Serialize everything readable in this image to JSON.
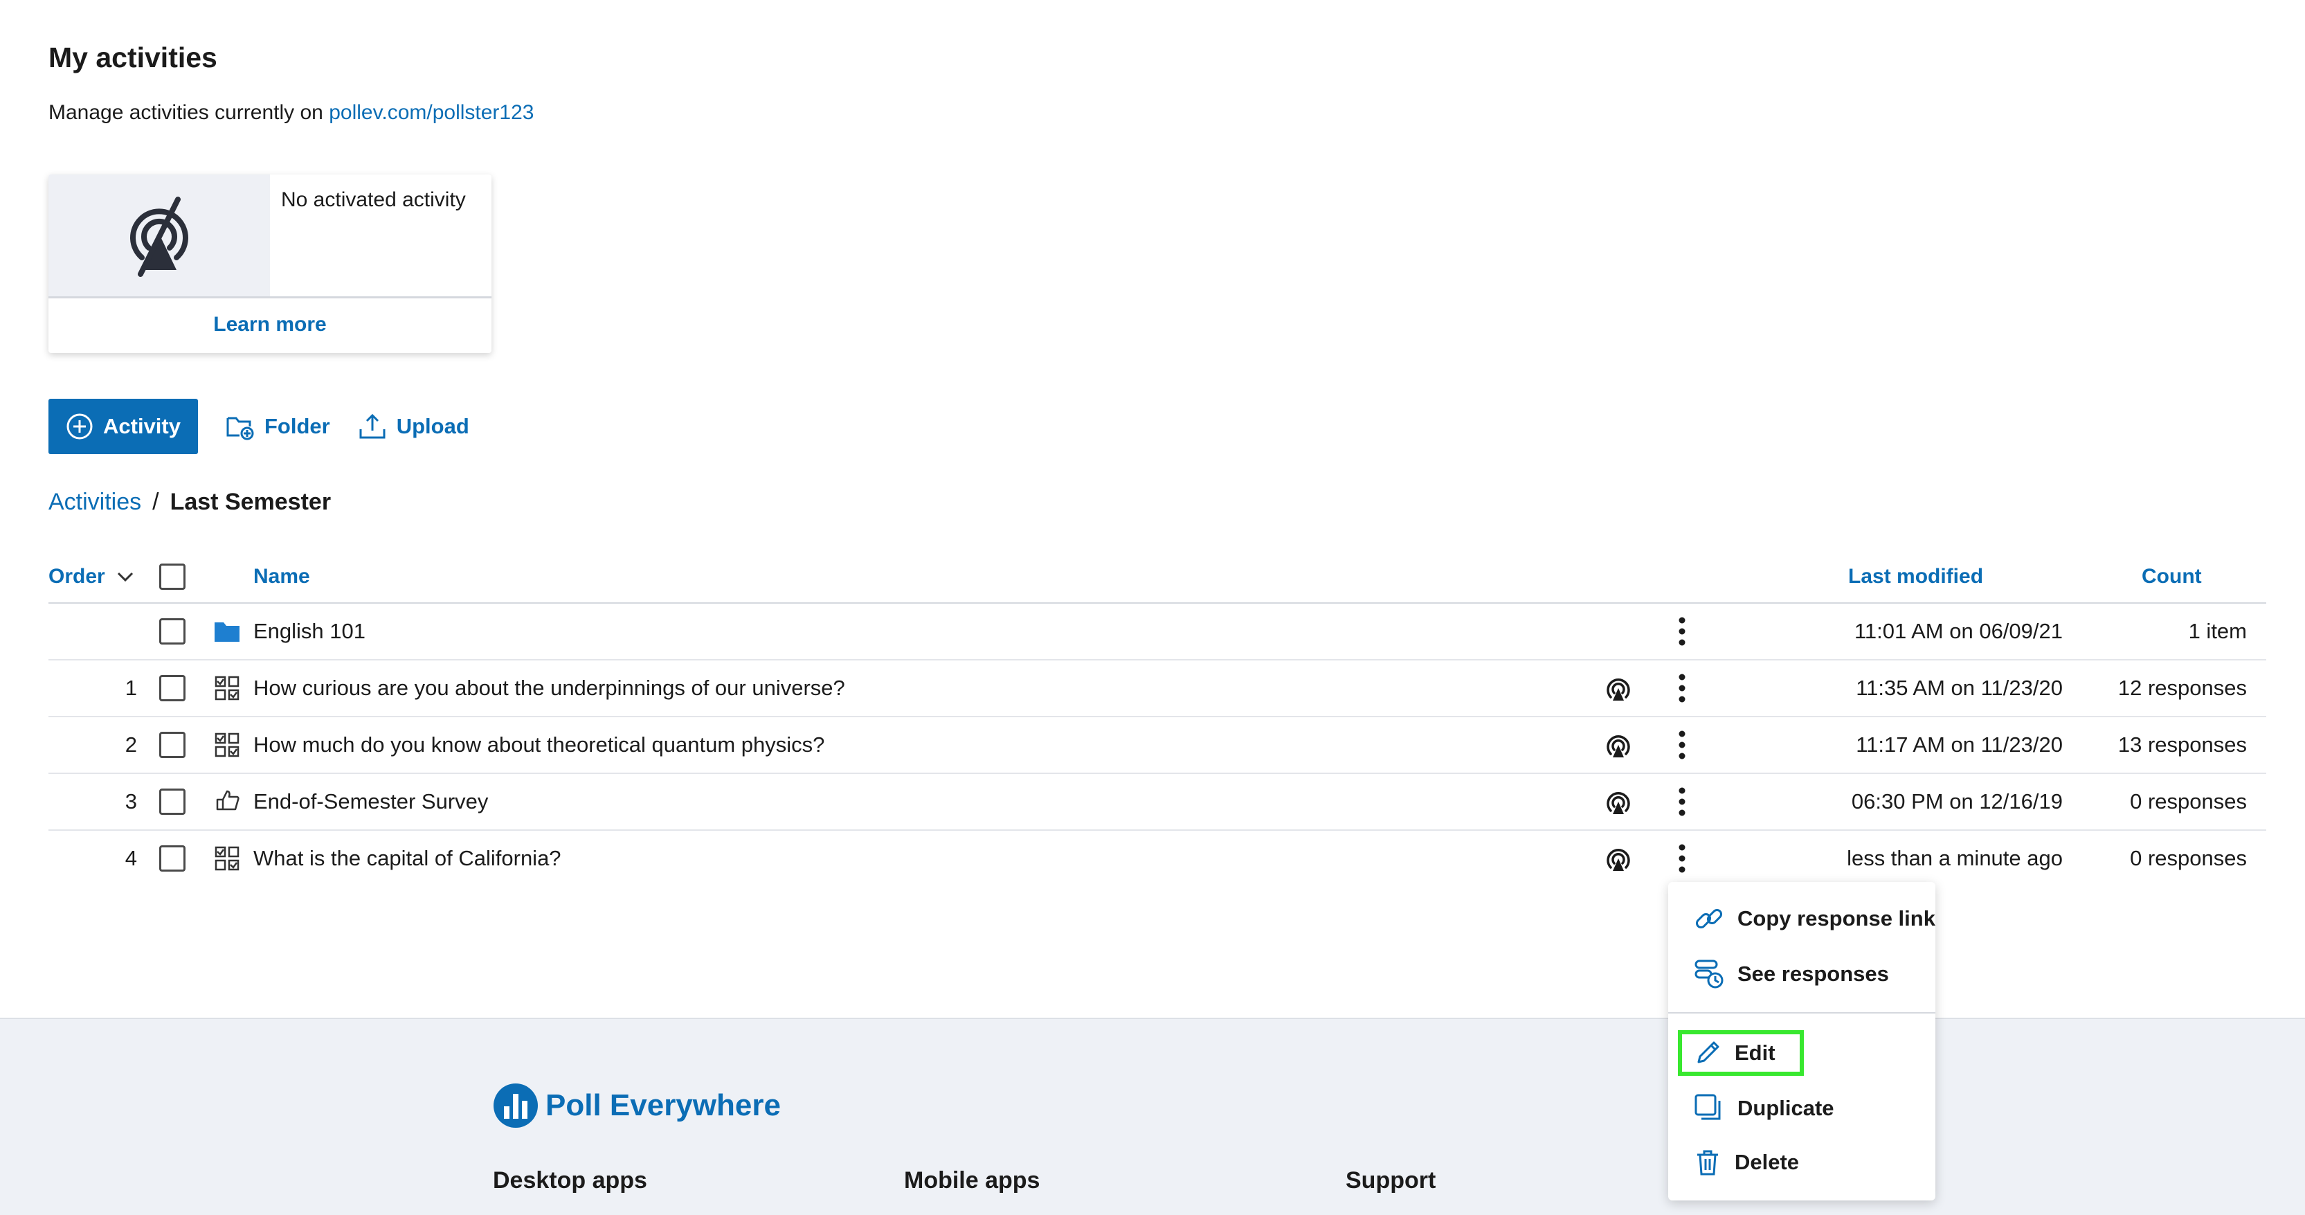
{
  "header": {
    "title": "My activities",
    "subtitle_prefix": "Manage activities currently on",
    "subtitle_link": "pollev.com/pollster123"
  },
  "activation_card": {
    "status": "No activated activity",
    "learn_more": "Learn more",
    "icon": "broadcast-off-icon"
  },
  "toolbar": {
    "activity": "Activity",
    "folder": "Folder",
    "upload": "Upload"
  },
  "breadcrumb": {
    "root": "Activities",
    "separator": "/",
    "current": "Last Semester"
  },
  "table": {
    "headers": {
      "order": "Order",
      "name": "Name",
      "last_modified": "Last modified",
      "count": "Count"
    },
    "rows": [
      {
        "order": "",
        "type": "folder",
        "name": "English 101",
        "broadcast": false,
        "modified": "11:01 AM on 06/09/21",
        "count": "1 item"
      },
      {
        "order": "1",
        "type": "multiple-choice",
        "name": "How curious are you about the underpinnings of our universe?",
        "broadcast": true,
        "modified": "11:35 AM on 11/23/20",
        "count": "12 responses"
      },
      {
        "order": "2",
        "type": "multiple-choice",
        "name": "How much do you know about theoretical quantum physics?",
        "broadcast": true,
        "modified": "11:17 AM on 11/23/20",
        "count": "13 responses"
      },
      {
        "order": "3",
        "type": "survey",
        "name": "End-of-Semester Survey",
        "broadcast": true,
        "modified": "06:30 PM on 12/16/19",
        "count": "0 responses"
      },
      {
        "order": "4",
        "type": "multiple-choice",
        "name": "What is the capital of California?",
        "broadcast": true,
        "modified": "less than a minute ago",
        "count": "0 responses"
      }
    ]
  },
  "context_menu": {
    "items": [
      {
        "label": "Copy response link",
        "icon": "link-icon"
      },
      {
        "label": "See responses",
        "icon": "responses-icon"
      },
      {
        "label": "Edit",
        "icon": "pencil-icon"
      },
      {
        "label": "Duplicate",
        "icon": "duplicate-icon"
      },
      {
        "label": "Delete",
        "icon": "trash-icon"
      }
    ]
  },
  "footer": {
    "brand": "Poll Everywhere",
    "columns": [
      "Desktop apps",
      "Mobile apps",
      "Support"
    ]
  },
  "colors": {
    "accent": "#0b6db5",
    "highlight": "#38e82f",
    "footer_bg": "#eef1f6"
  }
}
